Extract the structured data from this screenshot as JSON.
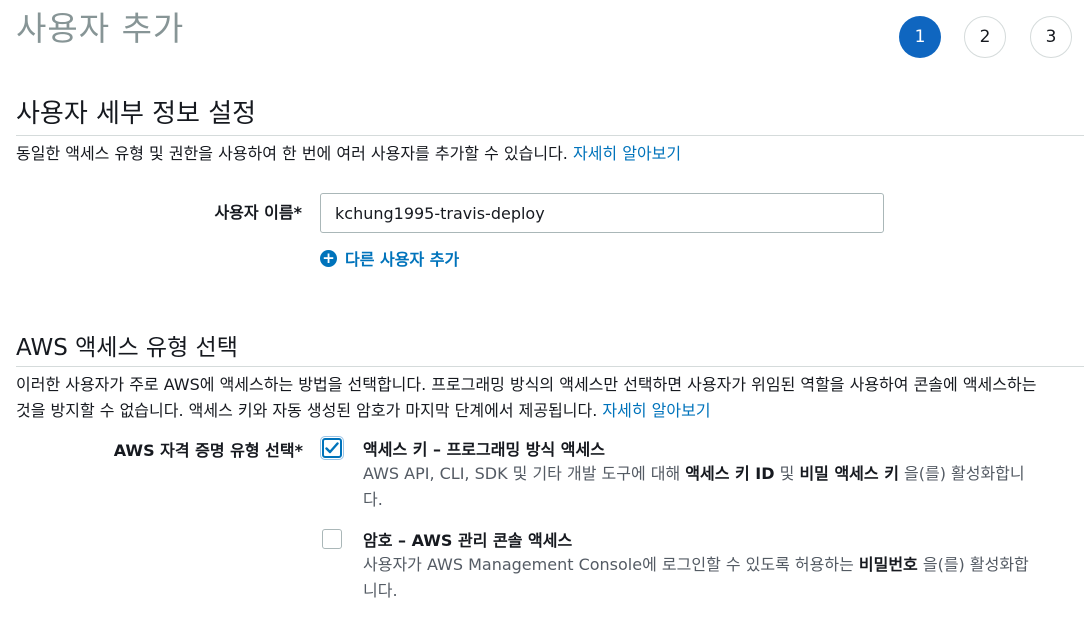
{
  "page": {
    "title": "사용자 추가"
  },
  "steps": [
    {
      "label": "1",
      "active": true
    },
    {
      "label": "2",
      "active": false
    },
    {
      "label": "3",
      "active": false
    }
  ],
  "details": {
    "title": "사용자 세부 정보 설정",
    "desc": "동일한 액세스 유형 및 권한을 사용하여 한 번에 여러 사용자를 추가할 수 있습니다.",
    "learn_more": "자세히 알아보기",
    "username_label": "사용자 이름*",
    "username_value": "kchung1995-travis-deploy",
    "add_user": "다른 사용자 추가"
  },
  "access": {
    "title": "AWS 액세스 유형 선택",
    "desc_line1": "이러한 사용자가 주로 AWS에 액세스하는 방법을 선택합니다. 프로그래밍 방식의 액세스만 선택하면 사용자가 위임된 역할을 사용하여 콘솔에 액세스하는",
    "desc_line2": "것을 방지할 수 없습니다. 액세스 키와 자동 생성된 암호가 마지막 단계에서 제공됩니다.",
    "learn_more": "자세히 알아보기",
    "credential_label": "AWS 자격 증명 유형 선택*",
    "options": [
      {
        "title": "액세스 키 – 프로그래밍 방식 액세스",
        "desc_prefix": "AWS API, CLI, SDK 및 기타 개발 도구에 대해 ",
        "bold1": "액세스 키 ID",
        "mid": " 및 ",
        "bold2": "비밀 액세스 키",
        "suffix": " 을(를) 활성화합니다.",
        "checked": true
      },
      {
        "title": "암호 – AWS 관리 콘솔 액세스",
        "desc_prefix": "사용자가 AWS Management Console에 로그인할 수 있도록 허용하는 ",
        "bold1": "비밀번호",
        "suffix": " 을(를) 활성화합니다.",
        "checked": false
      }
    ]
  },
  "colors": {
    "accent": "#0073bb",
    "step_active": "#0f66c0",
    "muted_title": "#879596"
  }
}
